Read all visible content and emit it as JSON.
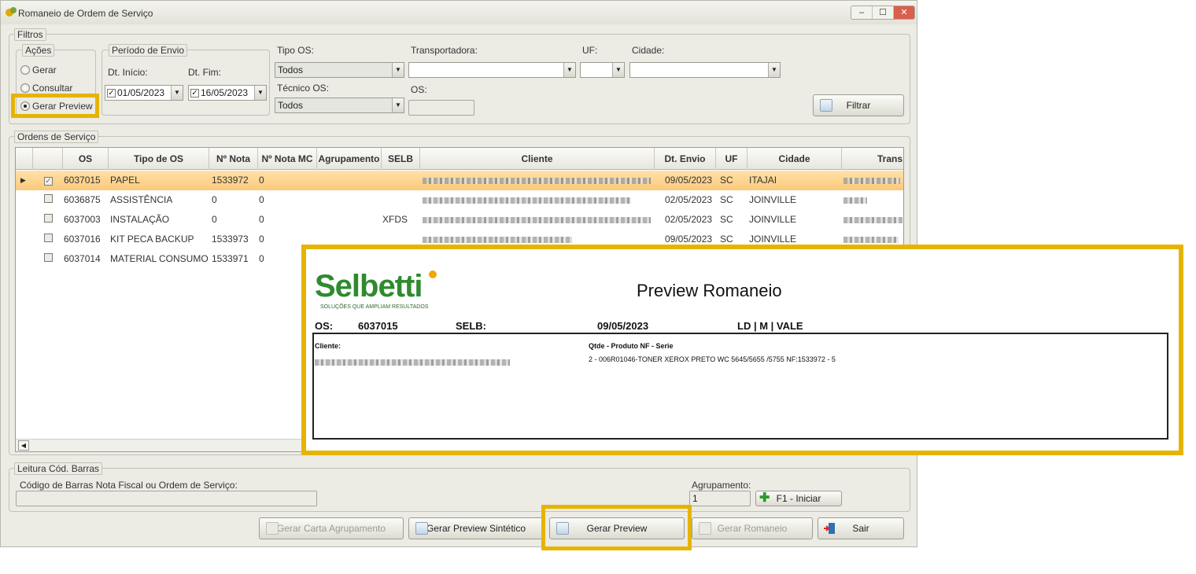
{
  "window": {
    "title": "Romaneio de Ordem de Serviço",
    "controls": [
      "–",
      "☐",
      "✕"
    ]
  },
  "filtros": {
    "legend": "Filtros",
    "acoes": {
      "legend": "Ações",
      "options": [
        "Gerar",
        "Consultar",
        "Gerar Preview"
      ],
      "selected": "Gerar Preview"
    },
    "periodo": {
      "legend": "Período de Envio",
      "inicio_label": "Dt. Início:",
      "inicio_value": "01/05/2023",
      "fim_label": "Dt. Fim:",
      "fim_value": "16/05/2023"
    },
    "tipo_os_label": "Tipo OS:",
    "tipo_os_value": "Todos",
    "tecnico_os_label": "Técnico OS:",
    "tecnico_os_value": "Todos",
    "transportadora_label": "Transportadora:",
    "transportadora_value": "",
    "uf_label": "UF:",
    "uf_value": "",
    "cidade_label": "Cidade:",
    "cidade_value": "",
    "os_label": "OS:",
    "os_value": "",
    "filtrar_label": "Filtrar"
  },
  "ordens": {
    "legend": "Ordens de Serviço",
    "columns": [
      "OS",
      "Tipo de OS",
      "Nº Nota",
      "Nº Nota MC",
      "Agrupamento",
      "SELB",
      "Cliente",
      "Dt. Envio",
      "UF",
      "Cidade",
      "Trans"
    ],
    "rows": [
      {
        "os": "6037015",
        "tipo": "PAPEL",
        "nota": "1533972",
        "nota_mc": "0",
        "agrup": "",
        "selb": "",
        "envio": "09/05/2023",
        "uf": "SC",
        "cidade": "ITAJAI",
        "checked": true,
        "selected": true
      },
      {
        "os": "6036875",
        "tipo": "ASSISTÊNCIA",
        "nota": "0",
        "nota_mc": "0",
        "agrup": "",
        "selb": "",
        "envio": "02/05/2023",
        "uf": "SC",
        "cidade": "JOINVILLE",
        "checked": false,
        "selected": false
      },
      {
        "os": "6037003",
        "tipo": "INSTALAÇÃO",
        "nota": "0",
        "nota_mc": "0",
        "agrup": "",
        "selb": "XFDS",
        "envio": "02/05/2023",
        "uf": "SC",
        "cidade": "JOINVILLE",
        "checked": false,
        "selected": false
      },
      {
        "os": "6037016",
        "tipo": "KIT PECA BACKUP",
        "nota": "1533973",
        "nota_mc": "0",
        "agrup": "",
        "selb": "",
        "envio": "09/05/2023",
        "uf": "SC",
        "cidade": "JOINVILLE",
        "checked": false,
        "selected": false
      },
      {
        "os": "6037014",
        "tipo": "MATERIAL CONSUMO",
        "nota": "1533971",
        "nota_mc": "0",
        "agrup": "",
        "selb": "",
        "envio": "",
        "uf": "",
        "cidade": "",
        "checked": false,
        "selected": false
      }
    ]
  },
  "leitura": {
    "legend": "Leitura Cód. Barras",
    "codigo_label": "Código de Barras Nota Fiscal ou Ordem de Serviço:",
    "codigo_value": "",
    "agrupamento_label": "Agrupamento:",
    "agrupamento_value": "1",
    "iniciar_label": "F1 - Iniciar"
  },
  "footer": {
    "carta": "Gerar Carta Agrupamento",
    "sintetico": "Gerar Preview Sintético",
    "preview": "Gerar Preview",
    "romaneio": "Gerar Romaneio",
    "sair": "Sair"
  },
  "preview": {
    "logo": "Selbetti",
    "logo_tagline": "SOLUÇÕES QUE AMPLIAM RESULTADOS",
    "title": "Preview Romaneio",
    "os_label": "OS:",
    "os_value": "6037015",
    "selb_label": "SELB:",
    "date": "09/05/2023",
    "ld": "LD | M | VALE",
    "cliente_label": "Cliente:",
    "qtde_label": "Qtde - Produto  NF - Serie",
    "item": "2 - 006R01046-TONER XEROX PRETO WC 5645/5655 /5755  NF:1533972 - 5"
  },
  "colors": {
    "highlight": "#e6b400",
    "selected_row": "#fbc97a",
    "logo_green": "#2e8b2e"
  }
}
